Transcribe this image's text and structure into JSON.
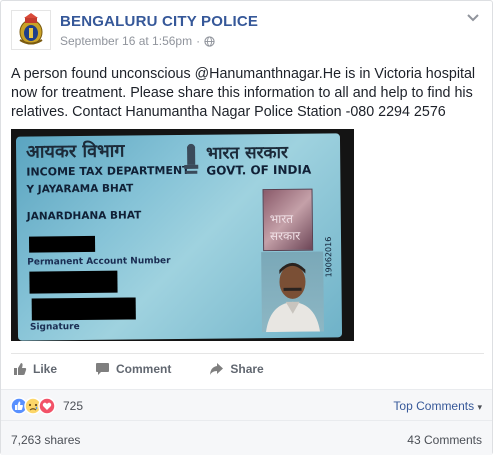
{
  "post": {
    "page_name": "BENGALURU CITY POLICE",
    "timestamp": "September 16 at 1:56pm",
    "separator": "·",
    "audience_icon": "globe-icon",
    "body_text": "A person found unconscious @Hanumanthnagar.He is in Victoria hospital now for treatment. Please share this information to all and help to find his relatives. Contact Hanumantha Nagar Police Station -080 2294 2576"
  },
  "photo": {
    "card_hindi_left": "आयकर विभाग",
    "card_department": "INCOME TAX DEPARTMENT",
    "card_hindi_right": "भारत सरकार",
    "card_govt": "GOVT. OF INDIA",
    "holder_name": "Y JAYARAMA BHAT",
    "father_name": "JANARDHANA BHAT",
    "pan_label": "Permanent Account Number",
    "signature_label": "Signature",
    "hologram_text": "भारत सरकार",
    "card_number": "19062016"
  },
  "actions": {
    "like": "Like",
    "comment": "Comment",
    "share": "Share"
  },
  "reactions": {
    "count": "725",
    "icons": [
      "like-reaction-icon",
      "sad-reaction-icon",
      "love-reaction-icon"
    ],
    "top_comments": "Top Comments",
    "top_comments_caret": "▾"
  },
  "stats": {
    "shares": "7,263 shares",
    "comments": "43 Comments"
  },
  "colors": {
    "link_blue": "#365899",
    "meta_gray": "#90949c",
    "action_gray": "#616770",
    "like_blue": "#5890ff",
    "love_red": "#f25268",
    "sad_yellow": "#fcd669"
  }
}
